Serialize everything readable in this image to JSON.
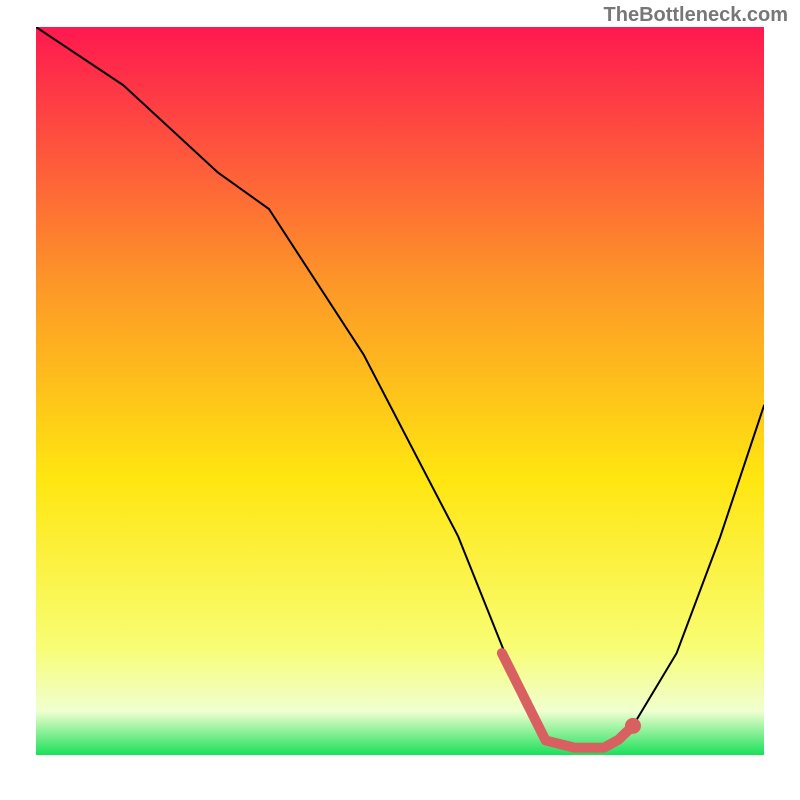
{
  "watermark": "TheBottleneck.com",
  "chart_data": {
    "type": "line",
    "title": "",
    "xlabel": "",
    "ylabel": "",
    "xlim": [
      0,
      100
    ],
    "ylim": [
      0,
      100
    ],
    "grid": false,
    "legend": false,
    "gradient_background": {
      "top": "#ff1850",
      "upper_mid": "#fd9628",
      "mid": "#ffe610",
      "lower_mid": "#f8fd72",
      "low_band": "#f0ffd0",
      "bottom": "#1be05a"
    },
    "series": [
      {
        "name": "bottleneck-curve",
        "color": "#000000",
        "width": 2,
        "x": [
          0,
          12,
          25,
          32,
          45,
          58,
          62,
          66,
          70,
          74,
          78,
          82,
          88,
          94,
          100
        ],
        "y": [
          100,
          92,
          80,
          75,
          55,
          30,
          20,
          10,
          2,
          1,
          1,
          4,
          14,
          30,
          48
        ]
      }
    ],
    "highlighted_segment": {
      "name": "optimal-zone",
      "color": "#d86060",
      "width": 10,
      "x": [
        64,
        66,
        70,
        74,
        78,
        80,
        82
      ],
      "y": [
        14,
        10,
        2,
        1,
        1,
        2.1,
        4
      ]
    },
    "highlight_endpoint": {
      "color": "#d86060",
      "radius": 8,
      "x": 82,
      "y": 4
    }
  }
}
